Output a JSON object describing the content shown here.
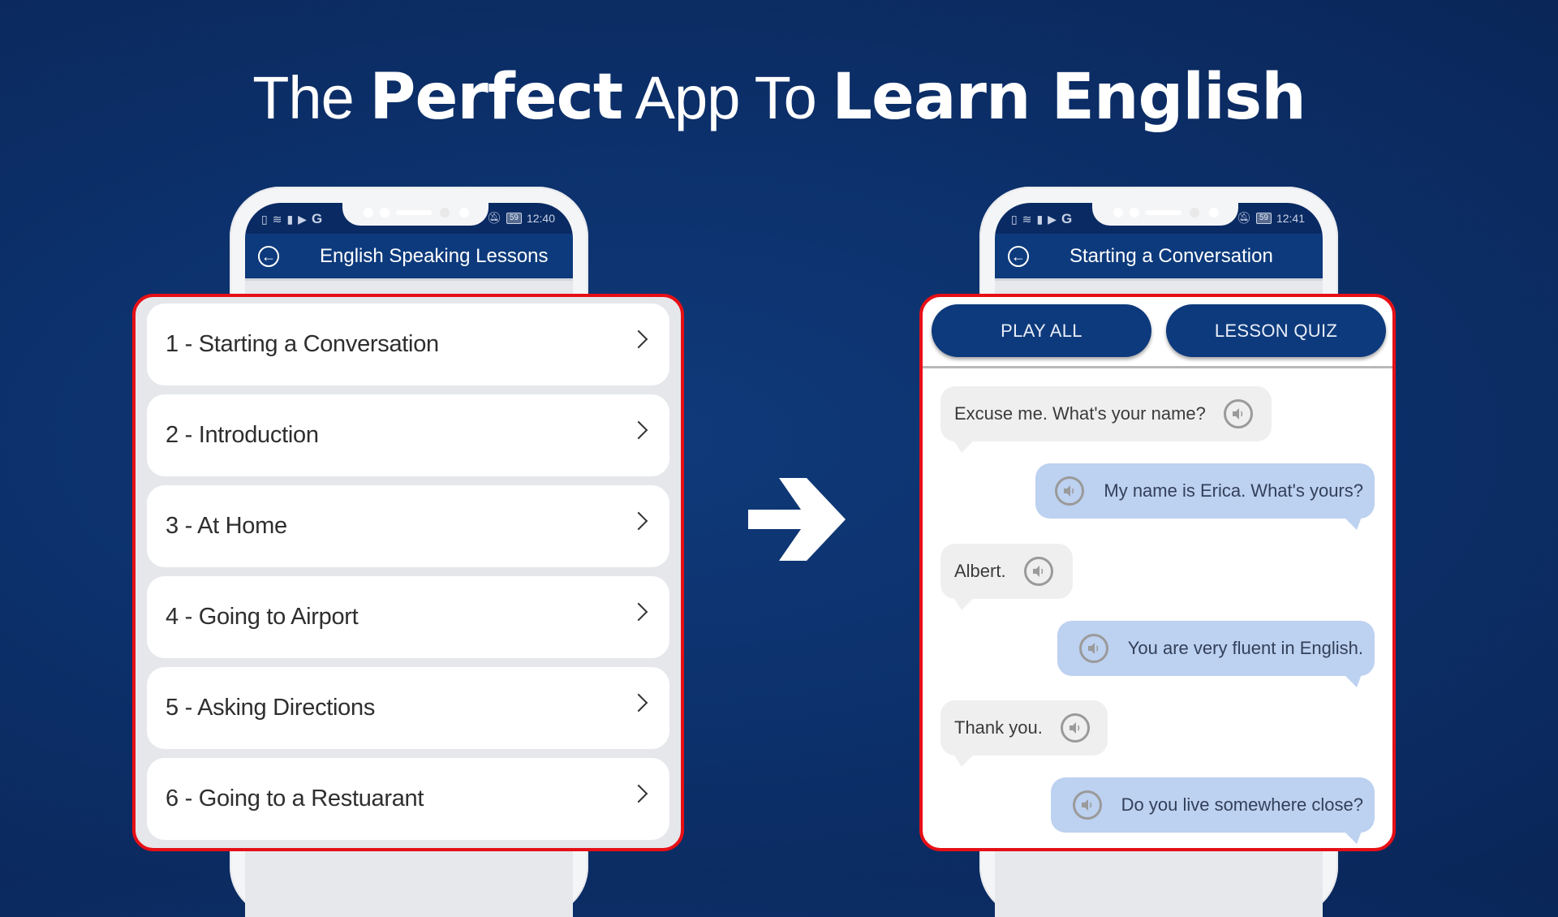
{
  "headline": {
    "part1": "The ",
    "part2": "Perfect",
    "part3": " App To ",
    "part4": "Learn English"
  },
  "colors": {
    "background": "#0c2f69",
    "app_bar": "#0d3a7c",
    "highlight_border": "#e60f16",
    "user_bubble": "#bdd1f0",
    "partner_bubble": "#efefef"
  },
  "left_phone": {
    "status": {
      "icons_left": [
        "sim-alert-icon",
        "wifi-icon",
        "battery-alert-icon",
        "youtube-icon",
        "google-icon"
      ],
      "icons_right": [
        "bell-off-icon",
        "battery-icon"
      ],
      "battery": "59",
      "time": "12:40"
    },
    "app_bar": {
      "back_icon": "back-arrow-circle-icon",
      "title": "English Speaking Lessons"
    },
    "lessons": [
      {
        "label": "1 - Starting a Conversation"
      },
      {
        "label": "2 - Introduction"
      },
      {
        "label": "3 - At Home"
      },
      {
        "label": "4 - Going to Airport"
      },
      {
        "label": "5 - Asking Directions"
      },
      {
        "label": "6 - Going to a Restuarant"
      }
    ]
  },
  "transition_icon": "right-arrow-icon",
  "right_phone": {
    "status": {
      "icons_left": [
        "sim-alert-icon",
        "wifi-icon",
        "battery-alert-icon",
        "youtube-icon",
        "google-icon"
      ],
      "icons_right": [
        "bell-off-icon",
        "battery-icon"
      ],
      "battery": "59",
      "time": "12:41"
    },
    "app_bar": {
      "back_icon": "back-arrow-circle-icon",
      "title": "Starting a Conversation"
    },
    "buttons": {
      "play_all": "PLAY ALL",
      "lesson_quiz": "LESSON QUIZ"
    },
    "messages": [
      {
        "side": "partner",
        "text": "Excuse me. What's your name?"
      },
      {
        "side": "user",
        "text": "My name is Erica. What's yours?"
      },
      {
        "side": "partner",
        "text": "Albert."
      },
      {
        "side": "user",
        "text": "You are very fluent in English."
      },
      {
        "side": "partner",
        "text": "Thank you."
      },
      {
        "side": "user",
        "text": "Do you live somewhere close?"
      }
    ]
  }
}
